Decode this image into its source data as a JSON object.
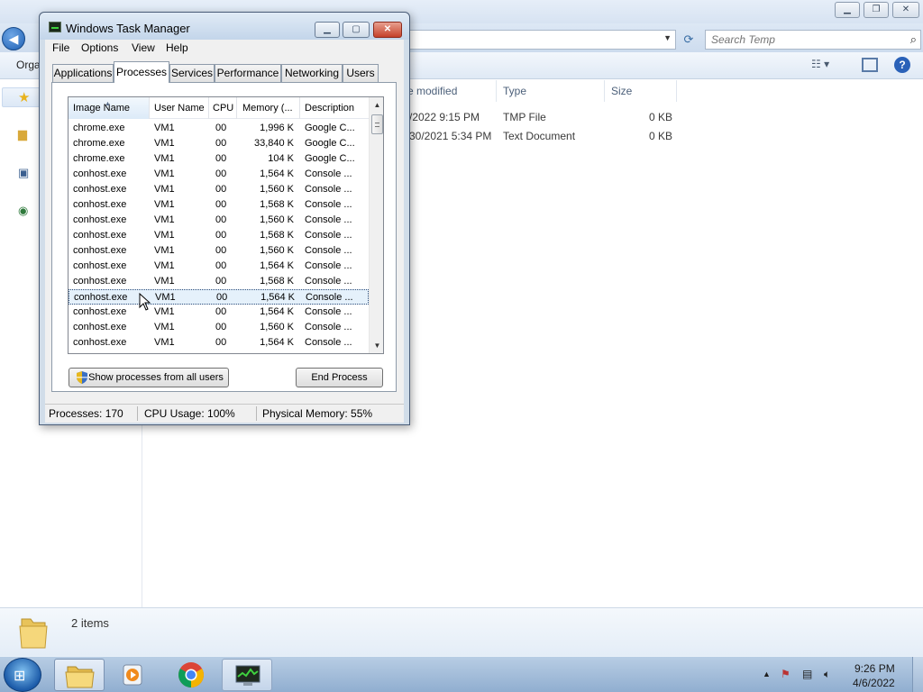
{
  "explorer": {
    "search_placeholder": "Search Temp",
    "toolbar_organize": "Orga",
    "columns": {
      "date_modified": "e modified",
      "type": "Type",
      "size": "Size"
    },
    "files": [
      {
        "date": "/2022 9:15 PM",
        "type": "TMP File",
        "size": "0 KB"
      },
      {
        "date": "30/2021 5:34 PM",
        "type": "Text Document",
        "size": "0 KB"
      }
    ],
    "status_items": "2 items"
  },
  "taskmgr": {
    "title": "Windows Task Manager",
    "menu": [
      "File",
      "Options",
      "View",
      "Help"
    ],
    "tabs": [
      "Applications",
      "Processes",
      "Services",
      "Performance",
      "Networking",
      "Users"
    ],
    "selected_tab": "Processes",
    "columns": [
      "Image Name",
      "User Name",
      "CPU",
      "Memory (...",
      "Description"
    ],
    "rows": [
      {
        "image": "chrome.exe",
        "user": "VM1",
        "cpu": "00",
        "memory": "1,996 K",
        "desc": "Google C..."
      },
      {
        "image": "chrome.exe",
        "user": "VM1",
        "cpu": "00",
        "memory": "33,840 K",
        "desc": "Google C..."
      },
      {
        "image": "chrome.exe",
        "user": "VM1",
        "cpu": "00",
        "memory": "104 K",
        "desc": "Google C..."
      },
      {
        "image": "conhost.exe",
        "user": "VM1",
        "cpu": "00",
        "memory": "1,564 K",
        "desc": "Console ..."
      },
      {
        "image": "conhost.exe",
        "user": "VM1",
        "cpu": "00",
        "memory": "1,560 K",
        "desc": "Console ..."
      },
      {
        "image": "conhost.exe",
        "user": "VM1",
        "cpu": "00",
        "memory": "1,568 K",
        "desc": "Console ..."
      },
      {
        "image": "conhost.exe",
        "user": "VM1",
        "cpu": "00",
        "memory": "1,560 K",
        "desc": "Console ..."
      },
      {
        "image": "conhost.exe",
        "user": "VM1",
        "cpu": "00",
        "memory": "1,568 K",
        "desc": "Console ..."
      },
      {
        "image": "conhost.exe",
        "user": "VM1",
        "cpu": "00",
        "memory": "1,560 K",
        "desc": "Console ..."
      },
      {
        "image": "conhost.exe",
        "user": "VM1",
        "cpu": "00",
        "memory": "1,564 K",
        "desc": "Console ..."
      },
      {
        "image": "conhost.exe",
        "user": "VM1",
        "cpu": "00",
        "memory": "1,568 K",
        "desc": "Console ..."
      },
      {
        "image": "conhost.exe",
        "user": "VM1",
        "cpu": "00",
        "memory": "1,564 K",
        "desc": "Console ..."
      },
      {
        "image": "conhost.exe",
        "user": "VM1",
        "cpu": "00",
        "memory": "1,564 K",
        "desc": "Console ..."
      },
      {
        "image": "conhost.exe",
        "user": "VM1",
        "cpu": "00",
        "memory": "1,560 K",
        "desc": "Console ..."
      },
      {
        "image": "conhost.exe",
        "user": "VM1",
        "cpu": "00",
        "memory": "1,564 K",
        "desc": "Console ..."
      }
    ],
    "selected_row_index": 11,
    "show_all_button": "Show processes from all users",
    "end_process_button": "End Process",
    "status": {
      "processes": "Processes: 170",
      "cpu": "CPU Usage: 100%",
      "memory": "Physical Memory: 55%"
    }
  },
  "taskbar": {
    "time": "9:26 PM",
    "date": "4/6/2022",
    "apps": [
      "folder-icon",
      "media-player-icon",
      "chrome-icon",
      "task-manager-icon"
    ]
  },
  "colors": {
    "selection": "#e5f1fb",
    "titlebar": "#c3d5ea",
    "close_button": "#c5412b"
  }
}
